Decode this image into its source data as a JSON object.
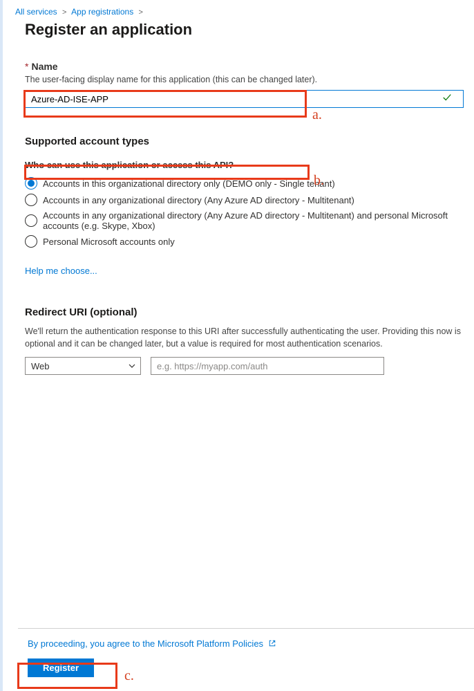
{
  "breadcrumb": {
    "all_services": "All services",
    "app_registrations": "App registrations"
  },
  "page_title": "Register an application",
  "name_field": {
    "label": "Name",
    "hint": "The user-facing display name for this application (this can be changed later).",
    "value": "Azure-AD-ISE-APP"
  },
  "account_types": {
    "heading": "Supported account types",
    "question": "Who can use this application or access this API?",
    "options": [
      "Accounts in this organizational directory only (DEMO only - Single tenant)",
      "Accounts in any organizational directory (Any Azure AD directory - Multitenant)",
      "Accounts in any organizational directory (Any Azure AD directory - Multitenant) and personal Microsoft accounts (e.g. Skype, Xbox)",
      "Personal Microsoft accounts only"
    ],
    "selected_index": 0,
    "help_link": "Help me choose..."
  },
  "redirect": {
    "heading": "Redirect URI (optional)",
    "description": "We'll return the authentication response to this URI after successfully authenticating the user. Providing this now is optional and it can be changed later, but a value is required for most authentication scenarios.",
    "platform_selected": "Web",
    "uri_placeholder": "e.g. https://myapp.com/auth"
  },
  "footer": {
    "policy_text": "By proceeding, you agree to the Microsoft Platform Policies",
    "register_label": "Register"
  },
  "annotations": {
    "a": "a.",
    "b": "b.",
    "c": "c."
  }
}
